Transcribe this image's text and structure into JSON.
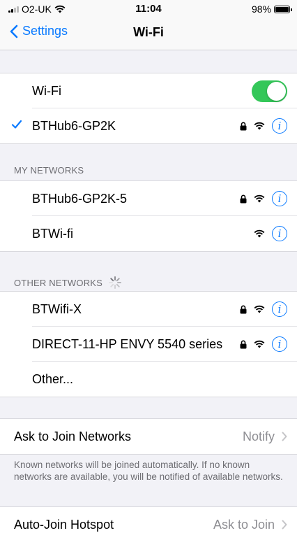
{
  "status_bar": {
    "carrier": "O2-UK",
    "time": "11:04",
    "battery": "98%",
    "battery_level": 0.98
  },
  "nav": {
    "back_label": "Settings",
    "title": "Wi-Fi"
  },
  "wifi_toggle": {
    "label": "Wi-Fi",
    "on": true
  },
  "connected": {
    "name": "BTHub6-GP2K",
    "secured": true
  },
  "my_networks": {
    "header": "MY NETWORKS",
    "items": [
      {
        "name": "BTHub6-GP2K-5",
        "secured": true
      },
      {
        "name": "BTWi-fi",
        "secured": false
      }
    ]
  },
  "other_networks": {
    "header": "OTHER NETWORKS",
    "items": [
      {
        "name": "BTWifi-X",
        "secured": true
      },
      {
        "name": "DIRECT-11-HP ENVY 5540 series",
        "secured": true
      }
    ],
    "other_label": "Other..."
  },
  "ask_to_join": {
    "label": "Ask to Join Networks",
    "value": "Notify",
    "footer": "Known networks will be joined automatically. If no known networks are available, you will be notified of available networks."
  },
  "auto_join": {
    "label": "Auto-Join Hotspot",
    "value": "Ask to Join"
  },
  "colors": {
    "accent": "#0a7aff",
    "toggle_on": "#34c759",
    "background": "#f2f2f7"
  }
}
